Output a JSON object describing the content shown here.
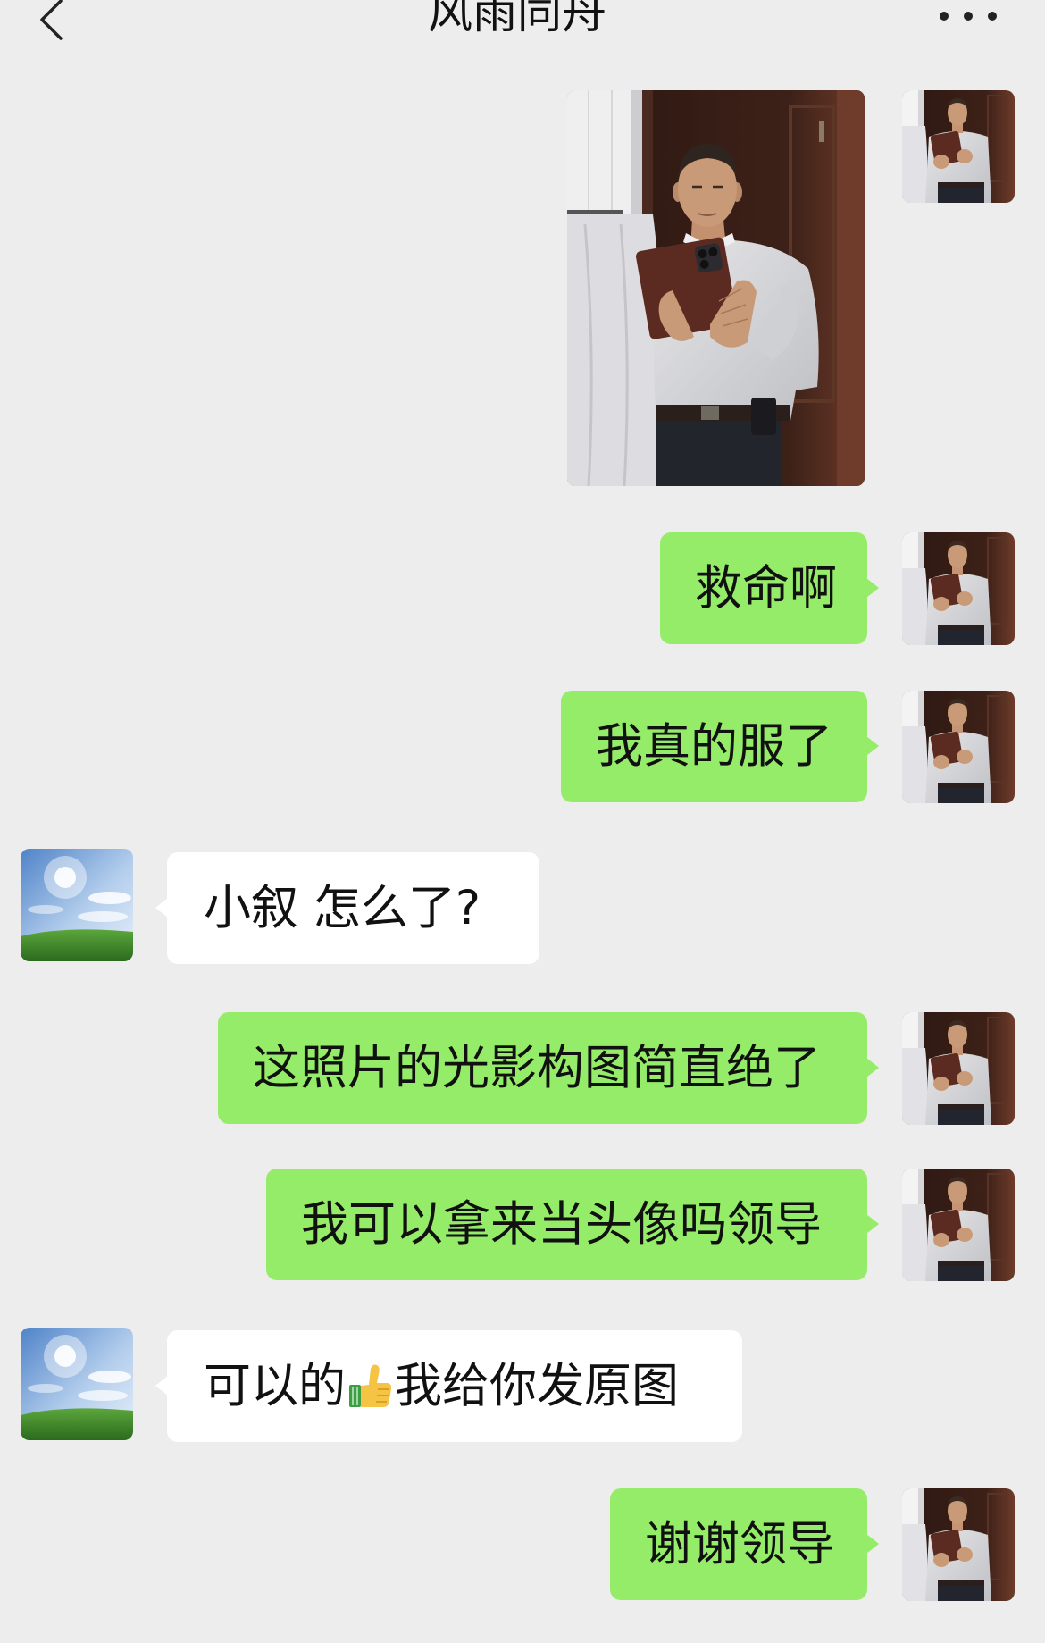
{
  "header": {
    "title": "风雨同舟",
    "back_icon": "chevron-left-icon",
    "more_icon": "more-dots-icon"
  },
  "messages": [
    {
      "sender": "self",
      "type": "image"
    },
    {
      "sender": "self",
      "type": "text",
      "text": "救命啊"
    },
    {
      "sender": "self",
      "type": "text",
      "text": "我真的服了"
    },
    {
      "sender": "other",
      "type": "text",
      "text": "小叙 怎么了?"
    },
    {
      "sender": "self",
      "type": "text",
      "text": "这照片的光影构图简直绝了"
    },
    {
      "sender": "self",
      "type": "text",
      "text": "我可以拿来当头像吗领导"
    },
    {
      "sender": "other",
      "type": "text",
      "text_before": "可以的",
      "emoji_icon": "thumbs-up-icon",
      "text_after": "我给你发原图"
    },
    {
      "sender": "self",
      "type": "text",
      "text": "谢谢领导"
    }
  ],
  "colors": {
    "background": "#ededed",
    "self_bubble": "#95ec69",
    "other_bubble": "#ffffff",
    "text": "#111111"
  }
}
